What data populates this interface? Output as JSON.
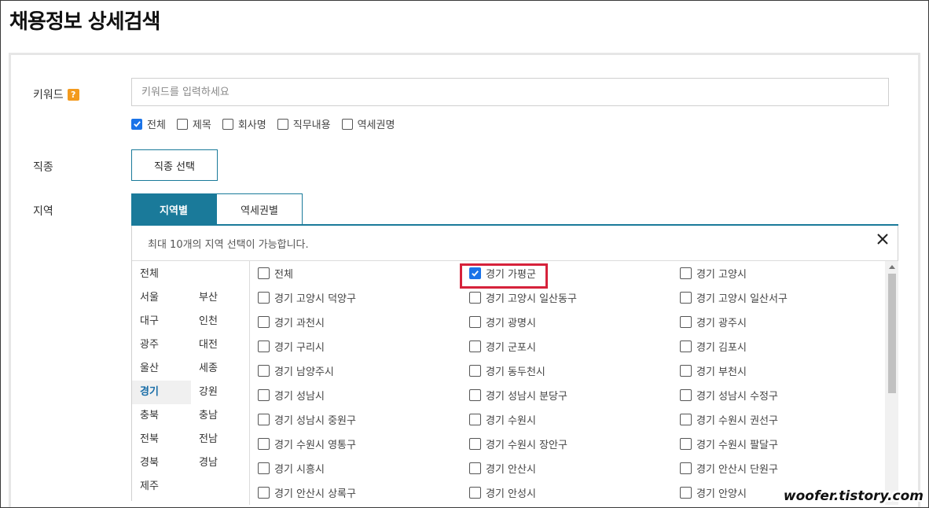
{
  "page": {
    "title": "채용정보 상세검색"
  },
  "keyword": {
    "label": "키워드",
    "help_badge": "?",
    "placeholder": "키워드를 입력하세요",
    "value": "",
    "options": [
      {
        "label": "전체",
        "checked": true
      },
      {
        "label": "제목",
        "checked": false
      },
      {
        "label": "회사명",
        "checked": false
      },
      {
        "label": "직무내용",
        "checked": false
      },
      {
        "label": "역세권명",
        "checked": false
      }
    ]
  },
  "job": {
    "label": "직종",
    "button": "직종 선택"
  },
  "region": {
    "label": "지역",
    "tabs": [
      {
        "label": "지역별",
        "active": true
      },
      {
        "label": "역세권별",
        "active": false
      }
    ],
    "notice": "최대 10개의 지역 선택이 가능합니다.",
    "close_icon": "close-icon",
    "sido": [
      "전체",
      "서울",
      "부산",
      "대구",
      "인천",
      "광주",
      "대전",
      "울산",
      "세종",
      "경기",
      "강원",
      "충북",
      "충남",
      "전북",
      "전남",
      "경북",
      "경남",
      "제주"
    ],
    "selected_sido": "경기",
    "sigungu": [
      [
        "전체",
        "경기 가평군",
        "경기 고양시"
      ],
      [
        "경기 고양시 덕양구",
        "경기 고양시 일산동구",
        "경기 고양시 일산서구"
      ],
      [
        "경기 과천시",
        "경기 광명시",
        "경기 광주시"
      ],
      [
        "경기 구리시",
        "경기 군포시",
        "경기 김포시"
      ],
      [
        "경기 남양주시",
        "경기 동두천시",
        "경기 부천시"
      ],
      [
        "경기 성남시",
        "경기 성남시 분당구",
        "경기 성남시 수정구"
      ],
      [
        "경기 성남시 중원구",
        "경기 수원시",
        "경기 수원시 권선구"
      ],
      [
        "경기 수원시 영통구",
        "경기 수원시 장안구",
        "경기 수원시 팔달구"
      ],
      [
        "경기 시흥시",
        "경기 안산시",
        "경기 안산시 단원구"
      ],
      [
        "경기 안산시 상록구",
        "경기 안성시",
        "경기 안양시"
      ]
    ],
    "checked_sigungu": [
      "경기 가평군"
    ],
    "highlighted": "경기 가평군"
  },
  "watermark": "woofer.tistory.com",
  "colors": {
    "accent": "#1a7a9a",
    "checkbox": "#1a73e8",
    "highlight": "#d6223b",
    "badge": "#f39a1e"
  }
}
